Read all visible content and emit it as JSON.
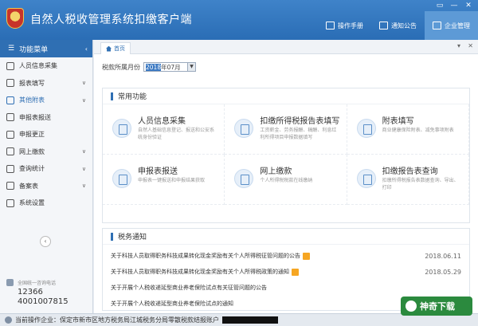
{
  "app": {
    "title": "自然人税收管理系统扣缴客户端",
    "window_controls": [
      "▭",
      "—",
      "✕"
    ]
  },
  "top_buttons": [
    {
      "label": "操作手册"
    },
    {
      "label": "通知公告"
    },
    {
      "label": "企业管理"
    }
  ],
  "sidebar": {
    "header": "功能菜单",
    "items": [
      {
        "label": "人员信息采集",
        "has_arrow": false
      },
      {
        "label": "报表填写",
        "has_arrow": true
      },
      {
        "label": "其他附表",
        "has_arrow": true
      },
      {
        "label": "申报表报送",
        "has_arrow": false
      },
      {
        "label": "申报更正",
        "has_arrow": false
      },
      {
        "label": "网上缴款",
        "has_arrow": true
      },
      {
        "label": "查询统计",
        "has_arrow": true
      },
      {
        "label": "备案表",
        "has_arrow": true
      },
      {
        "label": "系统设置",
        "has_arrow": false
      }
    ],
    "hotline_label": "全国统一咨询电话",
    "hotline_1": "12366",
    "hotline_2": "4001007815"
  },
  "tabs": {
    "home": "首页"
  },
  "period": {
    "label": "税款所属月份",
    "value_highlight": "2018",
    "value_rest": "年07月"
  },
  "common": {
    "title": "常用功能",
    "items": [
      {
        "name": "人员信息采集",
        "desc": "自然人基础信息登记、报送和公安系统身份验证"
      },
      {
        "name": "扣缴所得税报告表填写",
        "desc": "工资薪金、劳务报酬、稿酬、利息红利所得项目申报数据填写"
      },
      {
        "name": "附表填写",
        "desc": "商业健康保险附表、减免事项附表"
      },
      {
        "name": "申报表报送",
        "desc": "申报表一键报送和申报结果获取"
      },
      {
        "name": "网上缴款",
        "desc": "个人所得税税款在线缴纳"
      },
      {
        "name": "扣缴报告表查询",
        "desc": "扣缴所得税报告表数据查询、导出、打印"
      }
    ]
  },
  "notices": {
    "title": "税务通知",
    "items": [
      {
        "text": "关于科技人员取得职务科技成果转化现金奖励有关个人所得税征管问题的公告",
        "new": true,
        "date": "2018.06.11"
      },
      {
        "text": "关于科技人员取得职务科技成果转化现金奖励有关个人所得税政策的通知",
        "new": true,
        "date": "2018.05.29"
      },
      {
        "text": "关于开展个人税收递延型商业养老保险试点有关征管问题的公告",
        "new": false,
        "date": ""
      },
      {
        "text": "关于开展个人税收递延型商业养老保险试点的通知",
        "new": false,
        "date": ""
      }
    ]
  },
  "status": {
    "label": "当前操作企业：保定市新市区地方税务局江城税务分局零散税款结报账户"
  },
  "watermark": {
    "text": "神奇下载"
  }
}
